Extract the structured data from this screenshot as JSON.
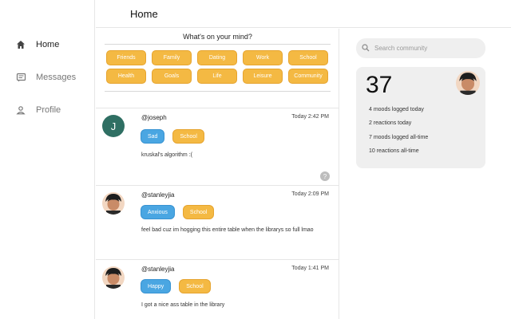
{
  "sidebar": {
    "items": [
      {
        "label": "Home",
        "icon": "home-icon",
        "active": true
      },
      {
        "label": "Messages",
        "icon": "chat-icon",
        "active": false
      },
      {
        "label": "Profile",
        "icon": "person-icon",
        "active": false
      }
    ]
  },
  "header": {
    "title": "Home"
  },
  "mind": {
    "question": "What's on your mind?",
    "chips": [
      "Friends",
      "Family",
      "Dating",
      "Work",
      "School",
      "Health",
      "Goals",
      "Life",
      "Leisure",
      "Community"
    ]
  },
  "posts": [
    {
      "username": "@joseph",
      "time": "Today 2:42 PM",
      "avatar_letter": "J",
      "mood": "Sad",
      "topic": "School",
      "text": "kruskal's algorithm :("
    },
    {
      "username": "@stanleyjia",
      "time": "Today 2:09 PM",
      "mood": "Anxious",
      "topic": "School",
      "text": "feel bad cuz im hogging this entire table when the librarys so full lmao"
    },
    {
      "username": "@stanleyjia",
      "time": "Today 1:41 PM",
      "mood": "Happy",
      "topic": "School",
      "text": "I got a nice ass table in the library"
    }
  ],
  "search": {
    "placeholder": "Search community"
  },
  "stats": {
    "count": "37",
    "lines": [
      "4 moods logged today",
      "2 reactions today",
      "7 moods logged all-time",
      "10 reactions all-time"
    ]
  },
  "colors": {
    "topic_chip": "#f4b943",
    "mood_chip": "#4aa6e2",
    "avatar_bg": "#2f6f63"
  }
}
